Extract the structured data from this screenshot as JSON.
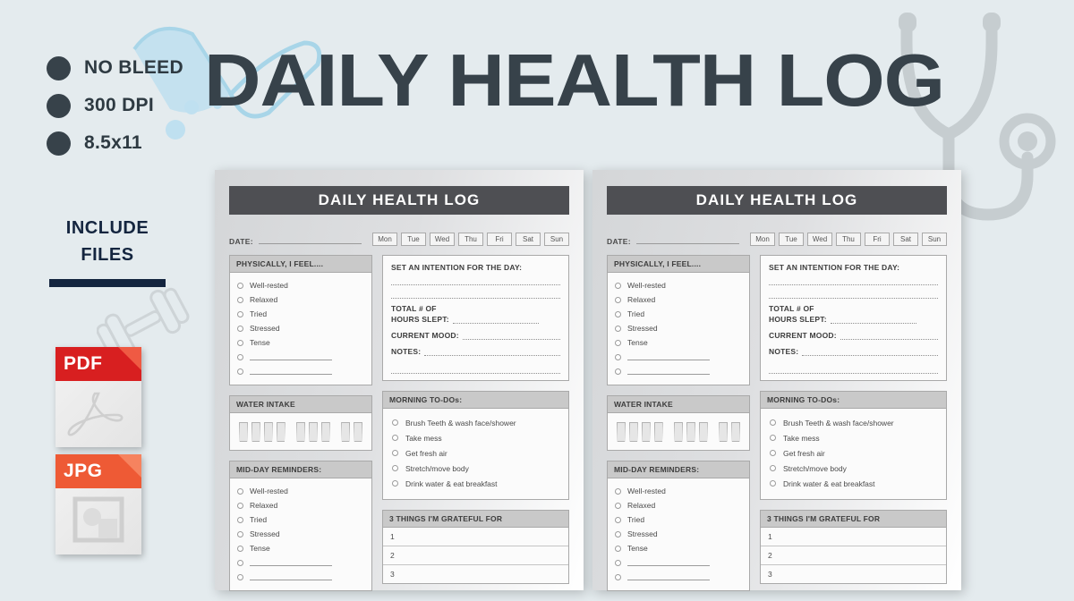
{
  "promo": {
    "features": [
      {
        "label": "NO BLEED",
        "icon": "bullet-dot-icon"
      },
      {
        "label": "300 DPI",
        "icon": "bullet-dot-icon"
      },
      {
        "label": "8.5x11",
        "icon": "bullet-dot-icon"
      }
    ],
    "include_files": {
      "line1": "INCLUDE",
      "line2": "FILES"
    },
    "file_types": [
      {
        "ext": "PDF",
        "icon": "pdf-file-icon",
        "band_color": "#d81f20"
      },
      {
        "ext": "JPG",
        "icon": "jpg-file-icon",
        "band_color": "#ee5a35"
      }
    ]
  },
  "main_title": "DAILY HEALTH LOG",
  "colors": {
    "background": "#e4ebee",
    "title_text": "#37424a",
    "navy": "#14253f",
    "banner": "#4e4f53",
    "panel_head": "#c9c9c9",
    "accent_blue": "#a9d6ea"
  },
  "page": {
    "banner_title": "DAILY  HEALTH LOG",
    "date_label": "DATE:",
    "days": [
      "Mon",
      "Tue",
      "Wed",
      "Thu",
      "Fri",
      "Sat",
      "Sun"
    ],
    "physically": {
      "heading": "PHYSICALLY, I FEEL....",
      "options": [
        "Well-rested",
        "Relaxed",
        "Tried",
        "Stressed",
        "Tense"
      ],
      "blank_lines": 2
    },
    "intention": {
      "heading": "SET AN INTENTION FOR THE DAY:",
      "dotted_lines": 2,
      "hours_label_line1": "TOTAL # OF",
      "hours_label_line2": "HOURS SLEPT:",
      "mood_label": "CURRENT MOOD:",
      "notes_label": "NOTES:"
    },
    "water": {
      "heading": "WATER INTAKE",
      "groups": [
        4,
        3,
        2
      ]
    },
    "morning_todos": {
      "heading": "MORNING TO-DOs:",
      "items": [
        "Brush Teeth & wash face/shower",
        "Take mess",
        "Get fresh air",
        "Stretch/move body",
        "Drink water & eat breakfast"
      ]
    },
    "midday": {
      "heading": "MID-DAY REMINDERS:",
      "options": [
        "Well-rested",
        "Relaxed",
        "Tried",
        "Stressed",
        "Tense"
      ],
      "blank_lines": 2
    },
    "grateful": {
      "heading": "3 THINGS I'M GRATEFUL FOR",
      "rows": [
        "1",
        "2",
        "3"
      ]
    }
  }
}
